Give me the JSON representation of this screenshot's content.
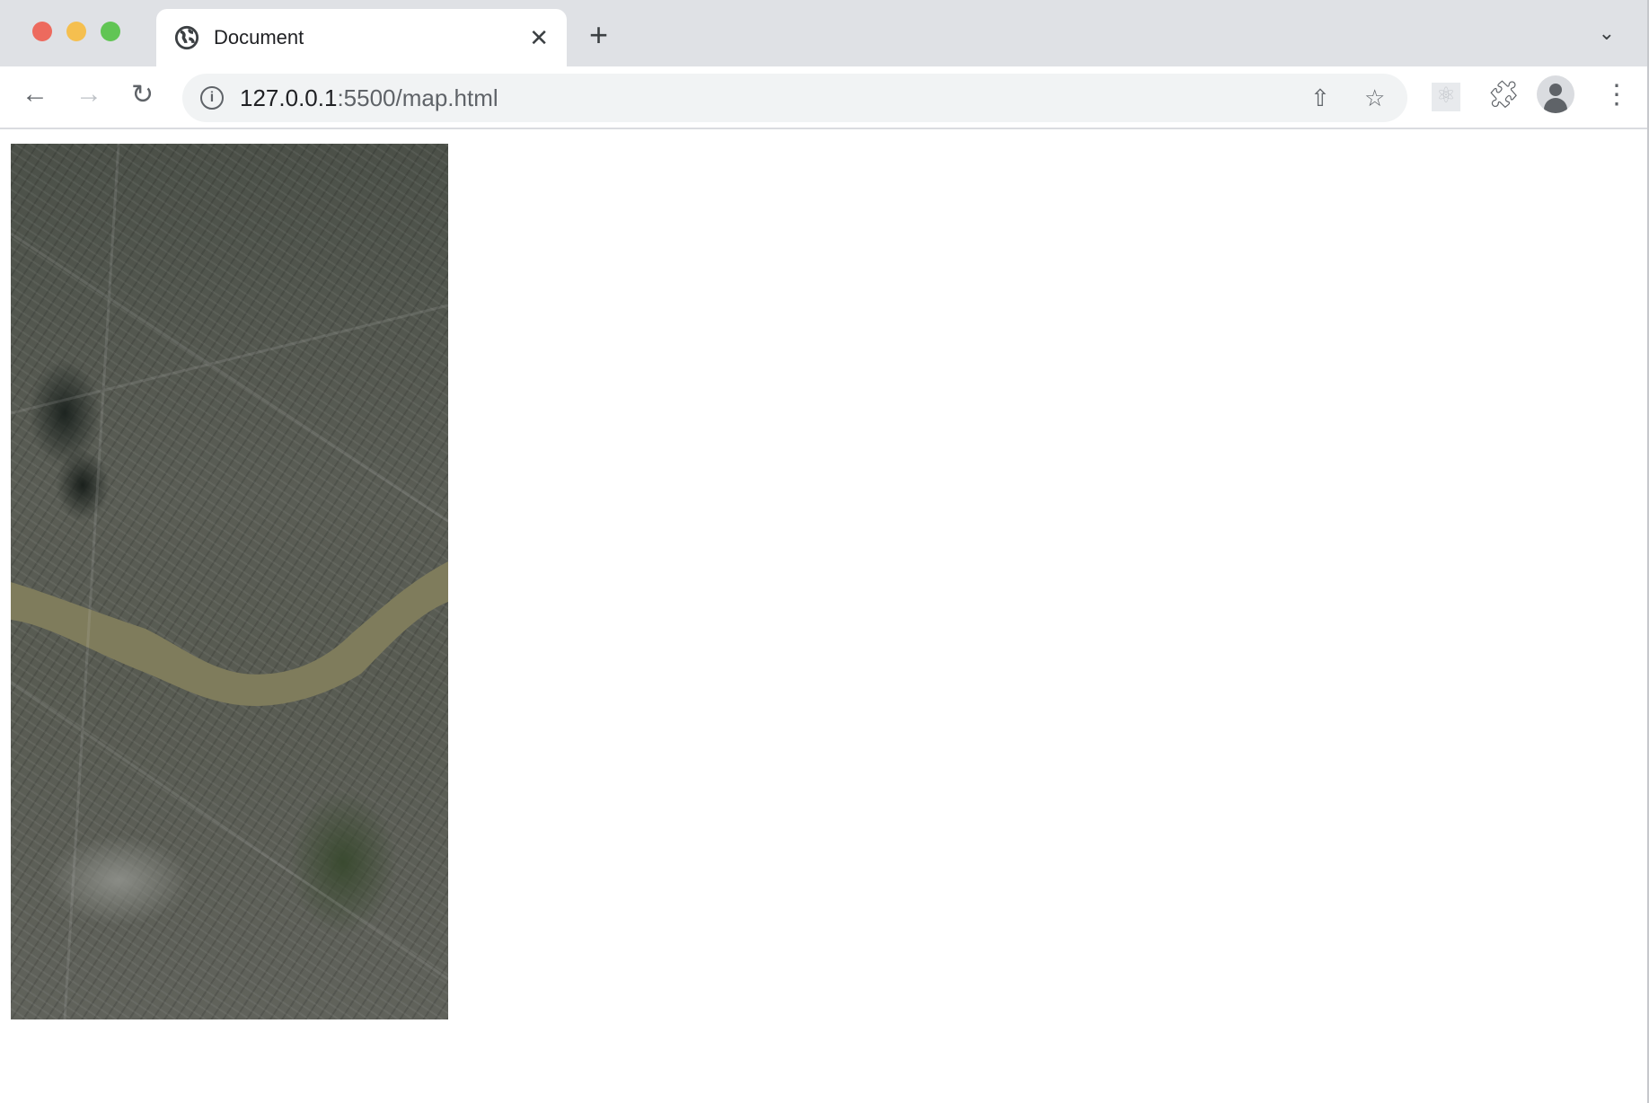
{
  "browser": {
    "tab": {
      "title": "Document",
      "close_icon": "close-icon",
      "favicon": "globe-icon"
    },
    "new_tab_label": "+",
    "address": {
      "host": "127.0.0.1",
      "rest": ":5500/map.html"
    },
    "colors": {
      "close": "#ed6a5e",
      "minimize": "#f5bf4f",
      "maximize": "#61c554",
      "river": "#7f7c5c"
    }
  },
  "page": {
    "map_alt": "satellite map"
  }
}
